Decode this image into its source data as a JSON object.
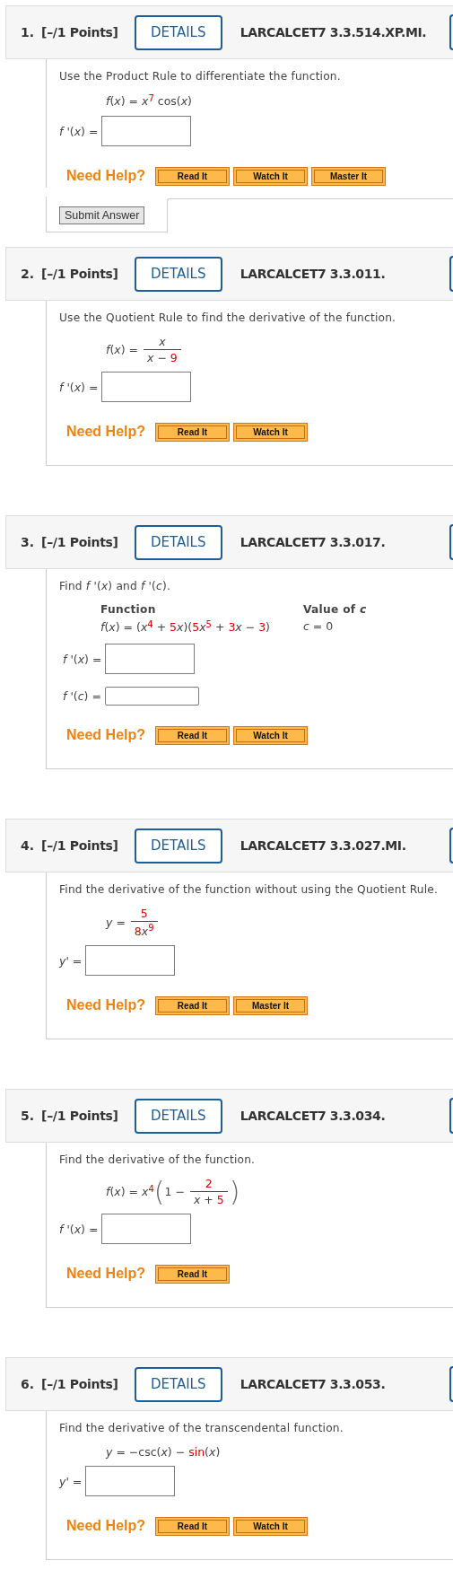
{
  "questions": [
    {
      "number": "1.",
      "points": "[–/1 Points]",
      "details": "DETAILS",
      "code": "LARCALCET7 3.3.514.XP.MI.",
      "prompt": "Use the Product Rule to differentiate the function.",
      "equation": [
        {
          "kind": "text",
          "text": "*f*(*x*) = *x*"
        },
        {
          "kind": "value",
          "text": "$^{7}$"
        },
        {
          "kind": "text",
          "text": " cos(*x*)"
        }
      ],
      "answers": [
        {
          "label": "*f* '(*x*) =",
          "kind": "tall"
        }
      ],
      "help_label": "Need Help?",
      "help_buttons": [
        "Read It",
        "Watch It",
        "Master It"
      ],
      "submit": "Submit Answer"
    },
    {
      "number": "2.",
      "points": "[–/1 Points]",
      "details": "DETAILS",
      "code": "LARCALCET7 3.3.011.",
      "prompt": "Use the Quotient Rule to find the derivative of the function.",
      "equation": [
        {
          "kind": "text",
          "text": "*f*(*x*) = "
        },
        {
          "kind": "fraction",
          "num": [
            {
              "kind": "text",
              "text": "*x*"
            }
          ],
          "den": [
            {
              "kind": "text",
              "text": "*x* − "
            },
            {
              "kind": "value",
              "text": "9"
            }
          ]
        }
      ],
      "answers": [
        {
          "label": "*f* '(*x*) =",
          "kind": "tall"
        }
      ],
      "help_label": "Need Help?",
      "help_buttons": [
        "Read It",
        "Watch It"
      ]
    },
    {
      "number": "3.",
      "points": "[–/1 Points]",
      "details": "DETAILS",
      "code": "LARCALCET7 3.3.017.",
      "prompt": "Find *f* '(*x*) and *f* '(*c*).",
      "table": {
        "columns": [
          "Function",
          "Value of *c*"
        ],
        "value": "*c* = 0"
      },
      "equation": [
        {
          "kind": "text",
          "text": "*f*(*x*) = (*x*"
        },
        {
          "kind": "value",
          "text": "$^{4}$"
        },
        {
          "kind": "text",
          "text": " + "
        },
        {
          "kind": "value",
          "text": "5"
        },
        {
          "kind": "text",
          "text": "*x*)("
        },
        {
          "kind": "value",
          "text": "5"
        },
        {
          "kind": "text",
          "text": "*x*"
        },
        {
          "kind": "value",
          "text": "$^{5}$"
        },
        {
          "kind": "text",
          "text": " + "
        },
        {
          "kind": "value",
          "text": "3"
        },
        {
          "kind": "text",
          "text": "*x* − "
        },
        {
          "kind": "value",
          "text": "3"
        },
        {
          "kind": "text",
          "text": ")"
        }
      ],
      "answers": [
        {
          "label": "*f* '(*x*) =",
          "kind": "tall"
        },
        {
          "label": "*f* '(*c*) =",
          "kind": "short"
        }
      ],
      "help_label": "Need Help?",
      "help_buttons": [
        "Read It",
        "Watch It"
      ]
    },
    {
      "number": "4.",
      "points": "[–/1 Points]",
      "details": "DETAILS",
      "code": "LARCALCET7 3.3.027.MI.",
      "prompt": "Find the derivative of the function without using the Quotient Rule.",
      "equation": [
        {
          "kind": "text",
          "text": "*y* = "
        },
        {
          "kind": "fraction",
          "num": [
            {
              "kind": "value",
              "text": "5"
            }
          ],
          "den": [
            {
              "kind": "value",
              "text": "8"
            },
            {
              "kind": "text",
              "text": "*x*"
            },
            {
              "kind": "value",
              "text": "$^{9}$"
            }
          ]
        }
      ],
      "answers": [
        {
          "label": "*y*' =",
          "kind": "tall"
        }
      ],
      "help_label": "Need Help?",
      "help_buttons": [
        "Read It",
        "Master It"
      ]
    },
    {
      "number": "5.",
      "points": "[–/1 Points]",
      "details": "DETAILS",
      "code": "LARCALCET7 3.3.034.",
      "prompt": "Find the derivative of the function.",
      "equation": [
        {
          "kind": "text",
          "text": "*f*(*x*) = *x*"
        },
        {
          "kind": "value",
          "text": "$^{4}$"
        },
        {
          "kind": "group",
          "open": "(",
          "close": ")",
          "items": [
            {
              "kind": "text",
              "text": "1 − "
            },
            {
              "kind": "fraction",
              "num": [
                {
                  "kind": "value",
                  "text": "2"
                }
              ],
              "den": [
                {
                  "kind": "text",
                  "text": "*x* + "
                },
                {
                  "kind": "value",
                  "text": "5"
                }
              ]
            }
          ]
        }
      ],
      "answers": [
        {
          "label": "*f* '(*x*) =",
          "kind": "tall"
        }
      ],
      "help_label": "Need Help?",
      "help_buttons": [
        "Read It"
      ]
    },
    {
      "number": "6.",
      "points": "[–/1 Points]",
      "details": "DETAILS",
      "code": "LARCALCET7 3.3.053.",
      "prompt": "Find the derivative of the transcendental function.",
      "equation": [
        {
          "kind": "text",
          "text": "*y* = −csc(*x*) − "
        },
        {
          "kind": "value",
          "text": "sin"
        },
        {
          "kind": "text",
          "text": "(*x*)"
        }
      ],
      "answers": [
        {
          "label": "*y*' =",
          "kind": "tall"
        }
      ],
      "help_label": "Need Help?",
      "help_buttons": [
        "Read It",
        "Watch It"
      ]
    }
  ]
}
